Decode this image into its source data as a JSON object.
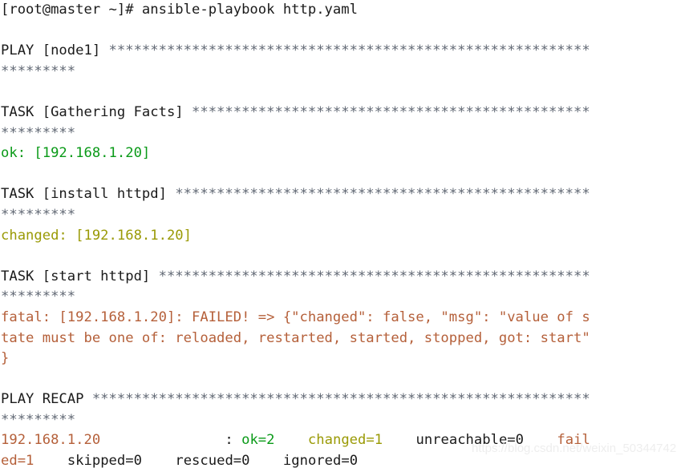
{
  "terminal": {
    "columns": 71,
    "background_color": "#ffffff",
    "default_text_color": "#1a1a1a",
    "colors": {
      "ok_green": "#0a9a18",
      "changed_yellow": "#9a9a06",
      "failed_red": "#b5603a",
      "star_gray": "#5f6672"
    },
    "prompt": "[root@master ~]# ",
    "command": "ansible-playbook http.yaml",
    "lines": [
      {
        "id": "command-line",
        "segments": [
          {
            "text": "[root@master ~]# ansible-playbook http.yaml",
            "color": "default"
          }
        ]
      },
      {
        "id": "blank-1",
        "segments": [
          {
            "text": " ",
            "color": "default"
          }
        ]
      },
      {
        "id": "play-node1-header",
        "segments": [
          {
            "text": "PLAY [node1] ",
            "color": "default"
          },
          {
            "text": "**********************************************************",
            "color": "star"
          }
        ]
      },
      {
        "id": "play-node1-header-wrap",
        "segments": [
          {
            "text": "*********",
            "color": "star"
          }
        ]
      },
      {
        "id": "blank-2",
        "segments": [
          {
            "text": " ",
            "color": "default"
          }
        ]
      },
      {
        "id": "task-gathering-facts-header",
        "segments": [
          {
            "text": "TASK [Gathering Facts] ",
            "color": "default"
          },
          {
            "text": "************************************************",
            "color": "star"
          }
        ]
      },
      {
        "id": "task-gathering-facts-header-wrap",
        "segments": [
          {
            "text": "*********",
            "color": "star"
          }
        ]
      },
      {
        "id": "task-gathering-facts-result",
        "segments": [
          {
            "text": "ok: [192.168.1.20]",
            "color": "green"
          }
        ]
      },
      {
        "id": "blank-3",
        "segments": [
          {
            "text": " ",
            "color": "default"
          }
        ]
      },
      {
        "id": "task-install-httpd-header",
        "segments": [
          {
            "text": "TASK [install httpd] ",
            "color": "default"
          },
          {
            "text": "**************************************************",
            "color": "star"
          }
        ]
      },
      {
        "id": "task-install-httpd-header-wrap",
        "segments": [
          {
            "text": "*********",
            "color": "star"
          }
        ]
      },
      {
        "id": "task-install-httpd-result",
        "segments": [
          {
            "text": "changed: [192.168.1.20]",
            "color": "yellow"
          }
        ]
      },
      {
        "id": "blank-4",
        "segments": [
          {
            "text": " ",
            "color": "default"
          }
        ]
      },
      {
        "id": "task-start-httpd-header",
        "segments": [
          {
            "text": "TASK [start httpd] ",
            "color": "default"
          },
          {
            "text": "****************************************************",
            "color": "star"
          }
        ]
      },
      {
        "id": "task-start-httpd-header-wrap",
        "segments": [
          {
            "text": "*********",
            "color": "star"
          }
        ]
      },
      {
        "id": "task-start-httpd-fatal",
        "segments": [
          {
            "text": "fatal: [192.168.1.20]: FAILED! => {\"changed\": false, \"msg\": \"value of s",
            "color": "red"
          }
        ]
      },
      {
        "id": "task-start-httpd-fatal-wrap-1",
        "segments": [
          {
            "text": "tate must be one of: reloaded, restarted, started, stopped, got: start\"",
            "color": "red"
          }
        ]
      },
      {
        "id": "task-start-httpd-fatal-wrap-2",
        "segments": [
          {
            "text": "}",
            "color": "red"
          }
        ]
      },
      {
        "id": "blank-5",
        "segments": [
          {
            "text": " ",
            "color": "default"
          }
        ]
      },
      {
        "id": "play-recap-header",
        "segments": [
          {
            "text": "PLAY RECAP ",
            "color": "default"
          },
          {
            "text": "************************************************************",
            "color": "star"
          }
        ]
      },
      {
        "id": "play-recap-header-wrap",
        "segments": [
          {
            "text": "*********",
            "color": "star"
          }
        ]
      },
      {
        "id": "play-recap-host-stats",
        "segments": [
          {
            "text": "192.168.1.20",
            "color": "red"
          },
          {
            "text": "               : ",
            "color": "default"
          },
          {
            "text": "ok=2",
            "color": "green"
          },
          {
            "text": "    ",
            "color": "default"
          },
          {
            "text": "changed=1",
            "color": "yellow"
          },
          {
            "text": "    ",
            "color": "default"
          },
          {
            "text": "unreachable=0",
            "color": "default"
          },
          {
            "text": "    ",
            "color": "default"
          },
          {
            "text": "fail",
            "color": "red"
          }
        ]
      },
      {
        "id": "play-recap-host-stats-wrap",
        "segments": [
          {
            "text": "ed=1",
            "color": "red"
          },
          {
            "text": "    ",
            "color": "default"
          },
          {
            "text": "skipped=0",
            "color": "default"
          },
          {
            "text": "    ",
            "color": "default"
          },
          {
            "text": "rescued=0",
            "color": "default"
          },
          {
            "text": "    ",
            "color": "default"
          },
          {
            "text": "ignored=0",
            "color": "default"
          }
        ]
      }
    ]
  },
  "watermark": {
    "text": "https://blog.csdn.net/weixin_50344742"
  }
}
